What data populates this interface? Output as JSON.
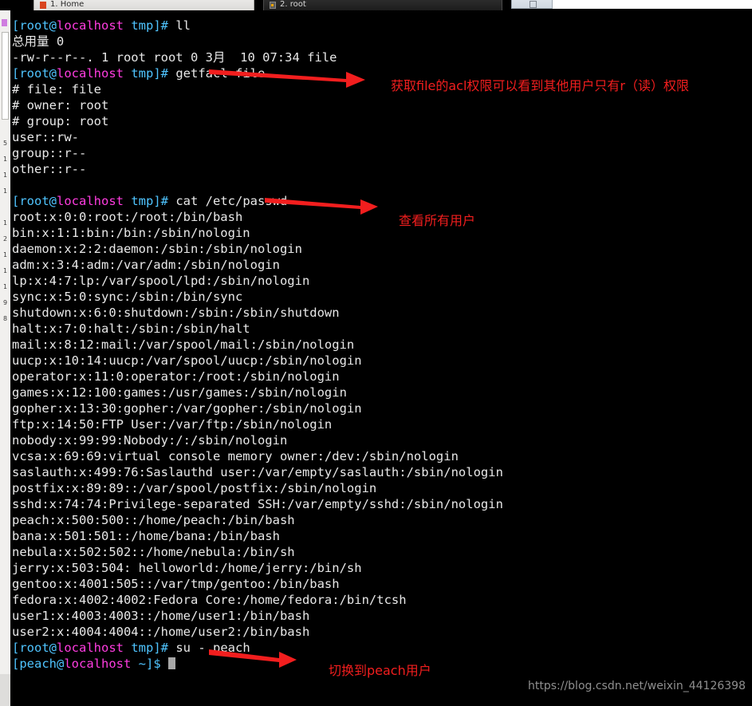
{
  "window": {
    "tabs": [
      {
        "label": "1. Home",
        "icon": "folder-icon",
        "active": true
      },
      {
        "label": "2. root",
        "icon": "terminal-icon",
        "active": false
      }
    ],
    "new_tab_label": ""
  },
  "sidebar": {
    "digits": "5\n1\n1\n1\n\n1\n2\n1\n1\n1\n9\n8"
  },
  "terminal": {
    "prompt_user_root": "[root@",
    "prompt_user_peach": "[peach@",
    "prompt_host": "localhost",
    "lines": [
      {
        "type": "prompt",
        "user": "[root@",
        "host": "localhost",
        "tail": " tmp]# ",
        "cmd": "ll"
      },
      {
        "type": "out",
        "text": "总用量 0"
      },
      {
        "type": "out",
        "text": "-rw-r--r--. 1 root root 0 3月  10 07:34 file"
      },
      {
        "type": "prompt",
        "user": "[root@",
        "host": "localhost",
        "tail": " tmp]# ",
        "cmd": "getfacl file"
      },
      {
        "type": "out",
        "text": "# file: file"
      },
      {
        "type": "out",
        "text": "# owner: root"
      },
      {
        "type": "out",
        "text": "# group: root"
      },
      {
        "type": "out",
        "text": "user::rw-"
      },
      {
        "type": "out",
        "text": "group::r--"
      },
      {
        "type": "out",
        "text": "other::r--"
      },
      {
        "type": "out",
        "text": ""
      },
      {
        "type": "prompt",
        "user": "[root@",
        "host": "localhost",
        "tail": " tmp]# ",
        "cmd": "cat /etc/passwd"
      },
      {
        "type": "out",
        "text": "root:x:0:0:root:/root:/bin/bash"
      },
      {
        "type": "out",
        "text": "bin:x:1:1:bin:/bin:/sbin/nologin"
      },
      {
        "type": "out",
        "text": "daemon:x:2:2:daemon:/sbin:/sbin/nologin"
      },
      {
        "type": "out",
        "text": "adm:x:3:4:adm:/var/adm:/sbin/nologin"
      },
      {
        "type": "out",
        "text": "lp:x:4:7:lp:/var/spool/lpd:/sbin/nologin"
      },
      {
        "type": "out",
        "text": "sync:x:5:0:sync:/sbin:/bin/sync"
      },
      {
        "type": "out",
        "text": "shutdown:x:6:0:shutdown:/sbin:/sbin/shutdown"
      },
      {
        "type": "out",
        "text": "halt:x:7:0:halt:/sbin:/sbin/halt"
      },
      {
        "type": "out",
        "text": "mail:x:8:12:mail:/var/spool/mail:/sbin/nologin"
      },
      {
        "type": "out",
        "text": "uucp:x:10:14:uucp:/var/spool/uucp:/sbin/nologin"
      },
      {
        "type": "out",
        "text": "operator:x:11:0:operator:/root:/sbin/nologin"
      },
      {
        "type": "out",
        "text": "games:x:12:100:games:/usr/games:/sbin/nologin"
      },
      {
        "type": "out",
        "text": "gopher:x:13:30:gopher:/var/gopher:/sbin/nologin"
      },
      {
        "type": "out",
        "text": "ftp:x:14:50:FTP User:/var/ftp:/sbin/nologin"
      },
      {
        "type": "out",
        "text": "nobody:x:99:99:Nobody:/:/sbin/nologin"
      },
      {
        "type": "out",
        "text": "vcsa:x:69:69:virtual console memory owner:/dev:/sbin/nologin"
      },
      {
        "type": "out",
        "text": "saslauth:x:499:76:Saslauthd user:/var/empty/saslauth:/sbin/nologin"
      },
      {
        "type": "out",
        "text": "postfix:x:89:89::/var/spool/postfix:/sbin/nologin"
      },
      {
        "type": "out",
        "text": "sshd:x:74:74:Privilege-separated SSH:/var/empty/sshd:/sbin/nologin"
      },
      {
        "type": "out",
        "text": "peach:x:500:500::/home/peach:/bin/bash"
      },
      {
        "type": "out",
        "text": "bana:x:501:501::/home/bana:/bin/bash"
      },
      {
        "type": "out",
        "text": "nebula:x:502:502::/home/nebula:/bin/sh"
      },
      {
        "type": "out",
        "text": "jerry:x:503:504: helloworld:/home/jerry:/bin/sh"
      },
      {
        "type": "out",
        "text": "gentoo:x:4001:505::/var/tmp/gentoo:/bin/bash"
      },
      {
        "type": "out",
        "text": "fedora:x:4002:4002:Fedora Core:/home/fedora:/bin/tcsh"
      },
      {
        "type": "out",
        "text": "user1:x:4003:4003::/home/user1:/bin/bash"
      },
      {
        "type": "out",
        "text": "user2:x:4004:4004::/home/user2:/bin/bash"
      },
      {
        "type": "prompt",
        "user": "[root@",
        "host": "localhost",
        "tail": " tmp]# ",
        "cmd": "su - peach"
      },
      {
        "type": "prompt-cursor",
        "user": "[peach@",
        "host": "localhost",
        "tail": " ~]$ ",
        "cmd": ""
      }
    ]
  },
  "annotations": [
    {
      "text": "获取file的acl权限可以看到其他用户只有r（读）权限",
      "name": "annotation-getfacl"
    },
    {
      "text": "查看所有用户",
      "name": "annotation-cat-passwd"
    },
    {
      "text": "切换到peach用户",
      "name": "annotation-su-peach"
    }
  ],
  "colors": {
    "annotation_red": "#f21e1e",
    "prompt_bracket": "#4fc4ff",
    "prompt_host": "#ff3ce0",
    "terminal_bg": "#000000",
    "terminal_fg": "#d6d6d6",
    "watermark": "#8f8f8f"
  },
  "watermark": {
    "text": "https://blog.csdn.net/weixin_44126398"
  }
}
